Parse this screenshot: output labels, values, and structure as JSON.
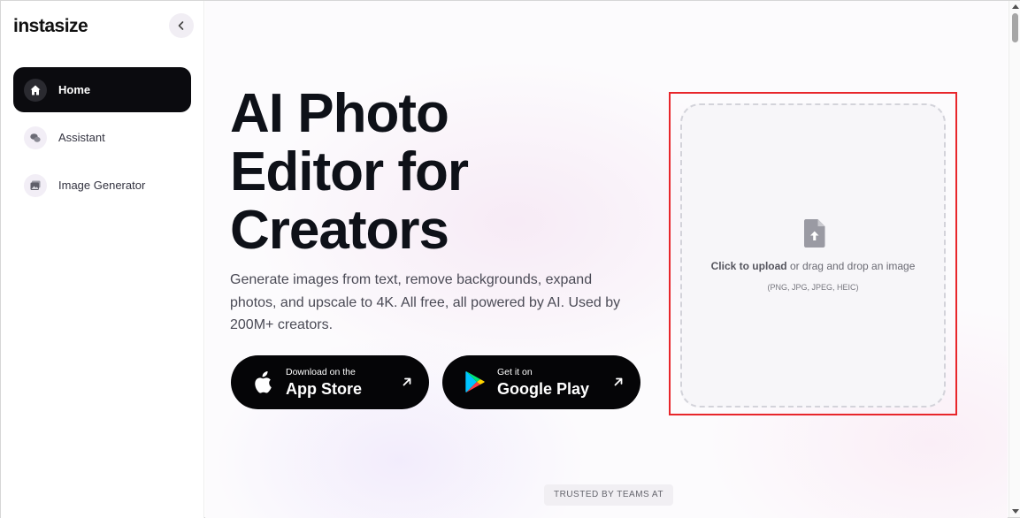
{
  "brand": {
    "logo_text": "instasize"
  },
  "sidebar": {
    "collapse_icon": "chevron-left-icon",
    "items": [
      {
        "label": "Home",
        "icon": "home-icon",
        "active": true
      },
      {
        "label": "Assistant",
        "icon": "chat-bubbles-icon",
        "active": false
      },
      {
        "label": "Image Generator",
        "icon": "image-gallery-icon",
        "active": false
      }
    ]
  },
  "hero": {
    "title_line1": "AI Photo",
    "title_line2": "Editor for",
    "title_line3": "Creators",
    "subtitle": "Generate images from text, remove backgrounds, expand photos, and upscale to 4K. All free, all powered by AI. Used by 200M+ creators."
  },
  "store_buttons": {
    "app_store": {
      "small": "Download on the",
      "big": "App Store",
      "icon": "apple-icon"
    },
    "google_play": {
      "small": "Get it on",
      "big": "Google Play",
      "icon": "google-play-icon"
    }
  },
  "upload": {
    "icon": "file-upload-icon",
    "cta": "Click to upload",
    "rest": " or drag and drop an image",
    "formats": "(PNG, JPG, JPEG, HEIC)"
  },
  "trusted_label": "TRUSTED BY TEAMS AT",
  "colors": {
    "accent_dark": "#0b0b0f",
    "highlight_border": "#e8262b",
    "background": "#fcfbfd"
  }
}
